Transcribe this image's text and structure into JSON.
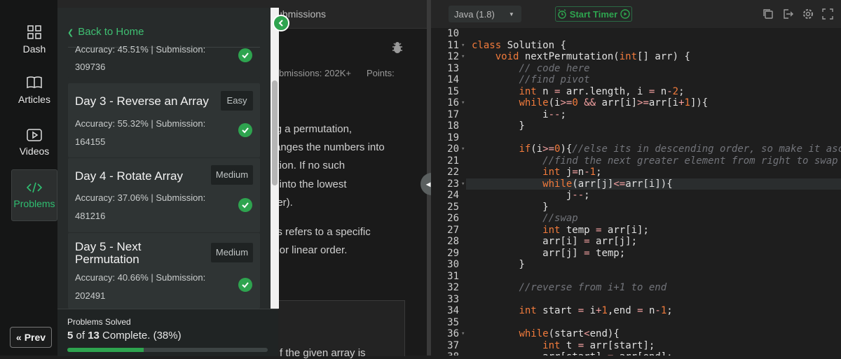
{
  "rail": {
    "items": [
      {
        "label": "Dash",
        "icon": "dashboard-icon"
      },
      {
        "label": "Articles",
        "icon": "book-icon"
      },
      {
        "label": "Videos",
        "icon": "video-icon"
      },
      {
        "label": "Problems",
        "icon": "code-icon"
      }
    ],
    "prev_label": "Prev"
  },
  "problem": {
    "tab_fragment": "ubmissions",
    "stats": "bmissions: 202K+",
    "points": "Points:",
    "lines": [
      "ing a permutation,",
      "rranges the numbers into",
      "tation. If no such",
      "rs into the lowest",
      "rder).",
      "ers refers to a specific",
      "te or linear order."
    ],
    "bottom_fragment": "f  the  given  array  is"
  },
  "drawer": {
    "back_label": "Back to Home",
    "partial_acc": "Accuracy: 45.51% | Submission:",
    "partial_sub": "309736",
    "cards": [
      {
        "title": "Day 3 - Reverse an Array",
        "badge": "Easy",
        "acc": "Accuracy: 55.32% | Submission:",
        "sub": "164155"
      },
      {
        "title": "Day 4 - Rotate Array",
        "badge": "Medium",
        "acc": "Accuracy: 37.06% | Submission:",
        "sub": "481216"
      },
      {
        "title_1": "Day 5 - Next",
        "title_2": "Permutation",
        "badge": "Medium",
        "acc": "Accuracy: 40.66% | Submission:",
        "sub": "202491"
      }
    ],
    "progress": {
      "heading": "Problems Solved",
      "solved": "5",
      "of_text": " of ",
      "total": "13",
      "complete_text": " Complete. (38%)",
      "fraction": 0.38
    }
  },
  "editor": {
    "language": "Java (1.8)",
    "timer_label": "Start Timer",
    "code_lines": [
      {
        "n": "10",
        "text": ""
      },
      {
        "n": "11",
        "text": "class Solution {"
      },
      {
        "n": "12",
        "text": "    void nextPermutation(int[] arr) {"
      },
      {
        "n": "13",
        "text": "        // code here"
      },
      {
        "n": "14",
        "text": "        //find pivot"
      },
      {
        "n": "15",
        "text": "        int n = arr.length, i = n-2;"
      },
      {
        "n": "16",
        "text": "        while(i>=0 && arr[i]>=arr[i+1]){"
      },
      {
        "n": "17",
        "text": "            i--;"
      },
      {
        "n": "18",
        "text": "        }"
      },
      {
        "n": "19",
        "text": ""
      },
      {
        "n": "20",
        "text": "        if(i>=0){//else its in descending order, so make it ascending"
      },
      {
        "n": "21",
        "text": "            //find the next greater element from right to swap"
      },
      {
        "n": "22",
        "text": "            int j=n-1;"
      },
      {
        "n": "23",
        "text": "            while(arr[j]<=arr[i]){"
      },
      {
        "n": "24",
        "text": "                j--;"
      },
      {
        "n": "25",
        "text": "            }"
      },
      {
        "n": "26",
        "text": "            //swap"
      },
      {
        "n": "27",
        "text": "            int temp = arr[i];"
      },
      {
        "n": "28",
        "text": "            arr[i] = arr[j];"
      },
      {
        "n": "29",
        "text": "            arr[j] = temp;"
      },
      {
        "n": "30",
        "text": "        }"
      },
      {
        "n": "31",
        "text": ""
      },
      {
        "n": "32",
        "text": "        //reverse from i+1 to end"
      },
      {
        "n": "33",
        "text": ""
      },
      {
        "n": "34",
        "text": "        int start = i+1,end = n-1;"
      },
      {
        "n": "35",
        "text": ""
      },
      {
        "n": "36",
        "text": "        while(start<end){"
      },
      {
        "n": "37",
        "text": "            int t = arr[start];"
      },
      {
        "n": "38",
        "text": "            arr[start] = arr[end];"
      }
    ],
    "folded_lines": [
      "11",
      "12",
      "16",
      "20",
      "23",
      "36"
    ],
    "highlight_line": "23"
  }
}
